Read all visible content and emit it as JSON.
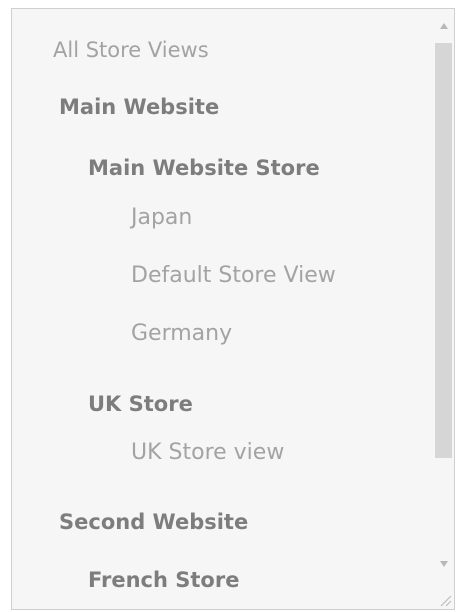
{
  "store_list": {
    "options": [
      {
        "label": "All Store Views",
        "level": "all"
      },
      {
        "label": "Main Website",
        "level": "website"
      },
      {
        "label": "Main Website Store",
        "level": "store"
      },
      {
        "label": "Japan",
        "level": "view"
      },
      {
        "label": "Default Store View",
        "level": "view"
      },
      {
        "label": "Germany",
        "level": "view"
      },
      {
        "label": "UK Store",
        "level": "store"
      },
      {
        "label": "UK Store view",
        "level": "view"
      },
      {
        "label": "Second Website",
        "level": "website"
      },
      {
        "label": "French Store",
        "level": "store"
      }
    ]
  },
  "scrollbar": {
    "up_icon": "triangle-up-icon",
    "down_icon": "triangle-down-icon",
    "grip_icon": "resize-grip-icon"
  }
}
